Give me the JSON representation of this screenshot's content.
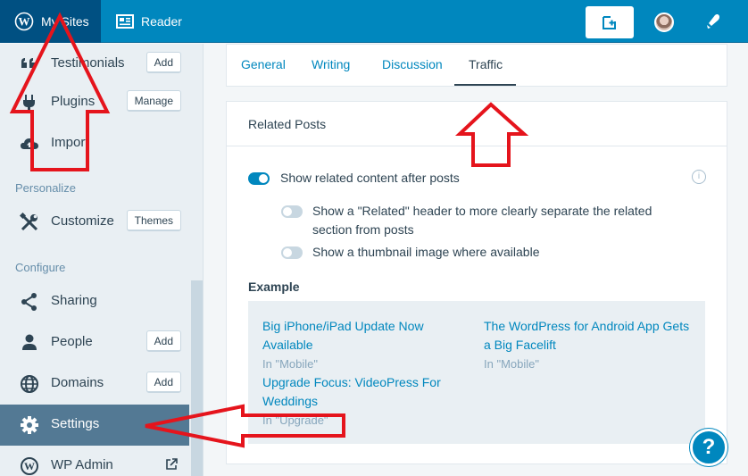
{
  "masterbar": {
    "my_sites_label": "My Sites",
    "reader_label": "Reader"
  },
  "sidebar": {
    "items": [
      {
        "label": "Testimonials",
        "button": "Add"
      },
      {
        "label": "Plugins",
        "button": "Manage"
      },
      {
        "label": "Import"
      },
      {
        "label": "Customize",
        "button": "Themes"
      },
      {
        "label": "Sharing"
      },
      {
        "label": "People",
        "button": "Add"
      },
      {
        "label": "Domains",
        "button": "Add"
      },
      {
        "label": "Settings"
      },
      {
        "label": "WP Admin"
      }
    ],
    "heading_personalize": "Personalize",
    "heading_configure": "Configure"
  },
  "tabs": [
    "General",
    "Writing",
    "Discussion",
    "Traffic"
  ],
  "related_posts": {
    "title": "Related Posts",
    "opt_show": "Show related content after posts",
    "opt_header_line1": "Show a \"Related\" header to more clearly separate the related",
    "opt_header_line2": "section from posts",
    "opt_thumb": "Show a thumbnail image where available",
    "example_label": "Example",
    "examples": [
      {
        "title_l1": "Big iPhone/iPad Update Now",
        "title_l2": "Available",
        "category": "In \"Mobile\""
      },
      {
        "title_l1": "The WordPress for Android App Gets",
        "title_l2": "a Big Facelift",
        "category": "In \"Mobile\""
      },
      {
        "title_l1": "Upgrade Focus: VideoPress For",
        "title_l2": "Weddings",
        "category": "In \"Upgrade\""
      }
    ]
  },
  "help_label": "?",
  "colors": {
    "masterbar": "#0087be",
    "masterbar_active": "#005082",
    "selected": "#537994",
    "annotation": "#e5141c"
  }
}
